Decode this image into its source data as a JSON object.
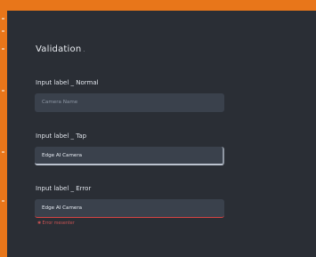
{
  "form": {
    "title": "Validation",
    "title_suffix": ".",
    "fields": [
      {
        "label": "Input label _ Normal",
        "placeholder": "Camera Name",
        "value": ""
      },
      {
        "label": "Input label _ Tap",
        "value": "Edge AI Camera"
      },
      {
        "label": "Input label _ Error",
        "value": "Edge AI Camera"
      }
    ],
    "error_message": "✱ Error mesenter"
  },
  "colors": {
    "frame": "#e8761a",
    "panel": "#2a2e35",
    "input_bg": "#3a414c",
    "error": "#d74343"
  }
}
